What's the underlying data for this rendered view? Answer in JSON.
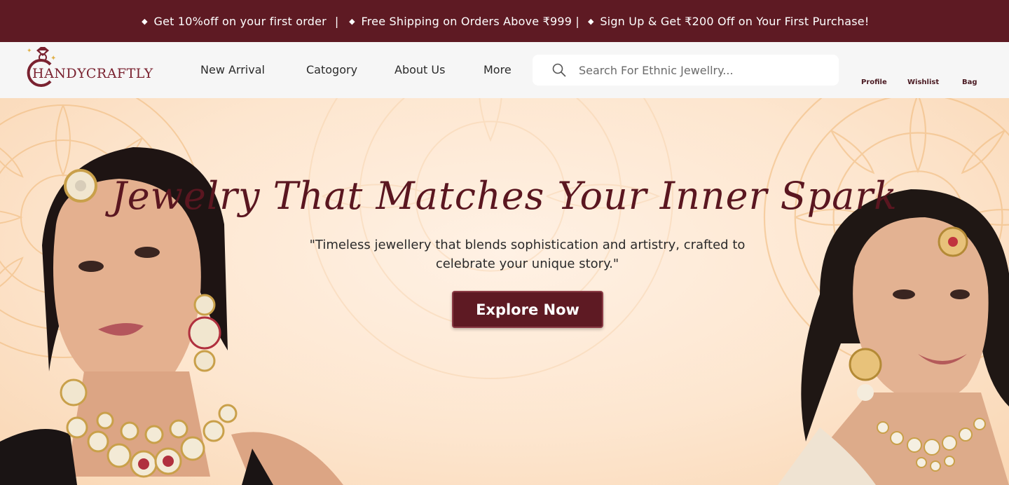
{
  "announcement": {
    "first": "Get 10%off on your first order",
    "separator": "|",
    "second": "Free Shipping on Orders Above ₹999 | ",
    "third": "Sign Up & Get ₹200 Off on Your First Purchase!"
  },
  "brand": {
    "name": "HANDYCRAFTLY"
  },
  "nav": {
    "items": [
      "New Arrival",
      "Catogory",
      "About Us",
      "More"
    ]
  },
  "search": {
    "placeholder": "Search For Ethnic Jewellry..."
  },
  "user": {
    "profile": "Profile",
    "wishlist": "Wishlist",
    "bag": "Bag"
  },
  "hero": {
    "headline": "Jewelry That Matches Your Inner Spark",
    "subtitle": "\"Timeless jewellery that blends sophistication and artistry, crafted to celebrate your unique story.\"",
    "cta": "Explore Now"
  },
  "colors": {
    "brand_maroon": "#5e1a23",
    "nav_bg": "#f6f6f6",
    "hero_bg": "#fde8d4",
    "gold": "#e0b14a"
  },
  "icons": [
    "diamond-icon",
    "search-icon",
    "ring-logo-icon"
  ]
}
